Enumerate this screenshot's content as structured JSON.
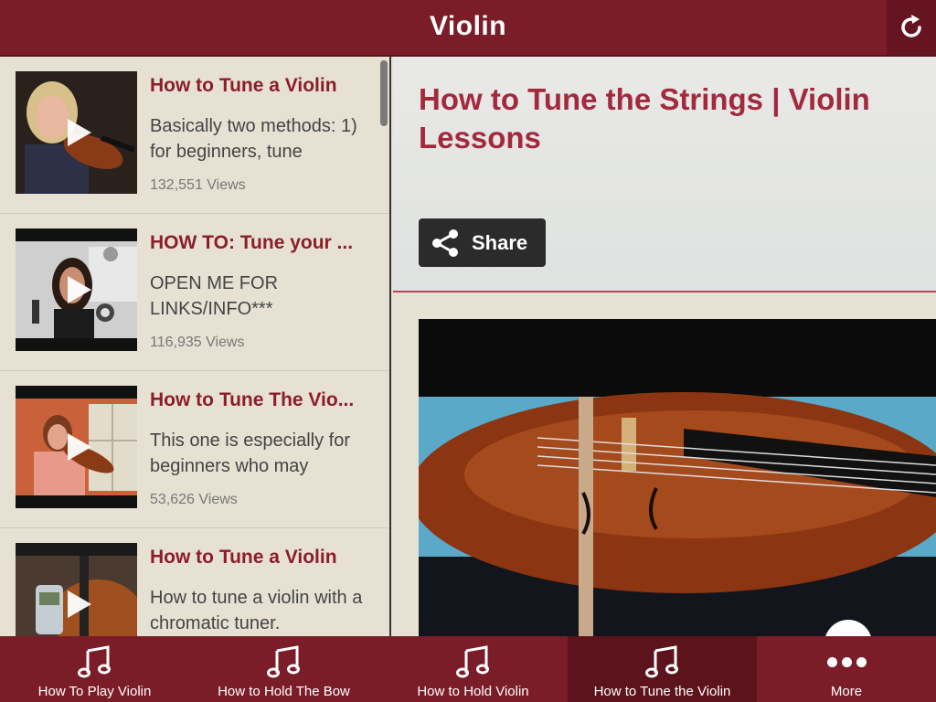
{
  "header": {
    "title": "Violin",
    "refresh_icon": "refresh-icon"
  },
  "videos": [
    {
      "title": "How to Tune a Violin",
      "description": "Basically two methods: 1) for beginners, tune",
      "views": "132,551 Views"
    },
    {
      "title": "HOW TO: Tune your ...",
      "description": "OPEN ME FOR LINKS/INFO***",
      "views": "116,935 Views"
    },
    {
      "title": "How to Tune The Vio...",
      "description": "This one is especially for beginners who may",
      "views": "53,626 Views"
    },
    {
      "title": "How to Tune a Violin",
      "description": "How to tune a violin with a chromatic tuner.",
      "views": ""
    }
  ],
  "detail": {
    "title": "How to Tune the Strings | Violin Lessons",
    "share_label": "Share"
  },
  "nav": [
    {
      "label": "How To Play Violin",
      "icon": "music-note-icon",
      "active": false
    },
    {
      "label": "How to Hold The Bow",
      "icon": "music-note-icon",
      "active": false
    },
    {
      "label": "How to Hold Violin",
      "icon": "music-note-icon",
      "active": false
    },
    {
      "label": "How to Tune the Violin",
      "icon": "music-note-icon",
      "active": true
    },
    {
      "label": "More",
      "icon": "more-dots-icon",
      "active": false
    }
  ],
  "colors": {
    "brand": "#7b1d28",
    "active_tab": "#5c131c",
    "title_red": "#8c1d2b"
  }
}
